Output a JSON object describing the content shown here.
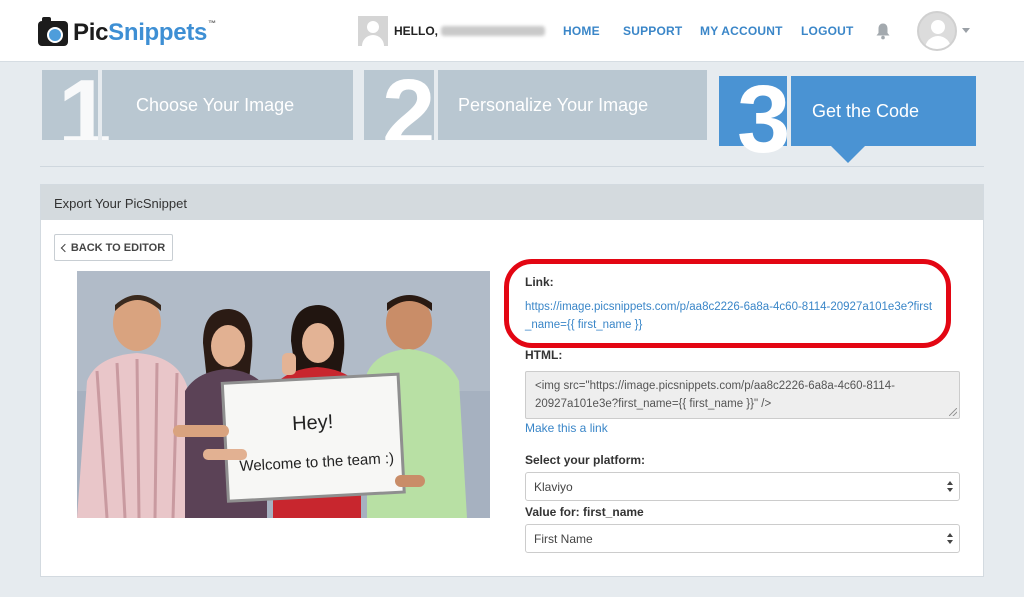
{
  "brand": {
    "name_part1": "Pic",
    "name_part2": "Snippets",
    "tm": "™"
  },
  "header": {
    "greeting": "HELLO,",
    "nav": [
      {
        "label": "HOME"
      },
      {
        "label": "SUPPORT"
      },
      {
        "label": "MY ACCOUNT"
      },
      {
        "label": "LOGOUT"
      }
    ]
  },
  "icons": {
    "bell": "bell-icon",
    "avatar": "user-avatar-icon",
    "caret": "caret-down-icon",
    "back": "chevron-left-icon"
  },
  "steps": [
    {
      "number": "1",
      "label": "Choose Your Image",
      "state": "inactive"
    },
    {
      "number": "2",
      "label": "Personalize Your Image",
      "state": "inactive"
    },
    {
      "number": "3",
      "label": "Get the Code",
      "state": "active"
    }
  ],
  "colors": {
    "accent": "#4a93d3",
    "link": "#3a86c8",
    "highlight": "#e30613",
    "inactive_step": "#b9c7d1"
  },
  "panel": {
    "title": "Export Your PicSnippet",
    "back_label": "BACK TO EDITOR",
    "image_text": {
      "line1": "Hey!",
      "line2": "Welcome to the team :)"
    },
    "link_label": "Link:",
    "link_url": "https://image.picsnippets.com/p/aa8c2226-6a8a-4c60-8114-20927a101e3e?first_name={{ first_name }}",
    "html_label": "HTML:",
    "html_code": "<img src=\"https://image.picsnippets.com/p/aa8c2226-6a8a-4c60-8114-20927a101e3e?first_name={{ first_name }}\" />",
    "make_link": "Make this a link",
    "platform_label": "Select your platform:",
    "platform_value": "Klaviyo",
    "value_label": "Value for: first_name",
    "value_value": "First Name"
  }
}
